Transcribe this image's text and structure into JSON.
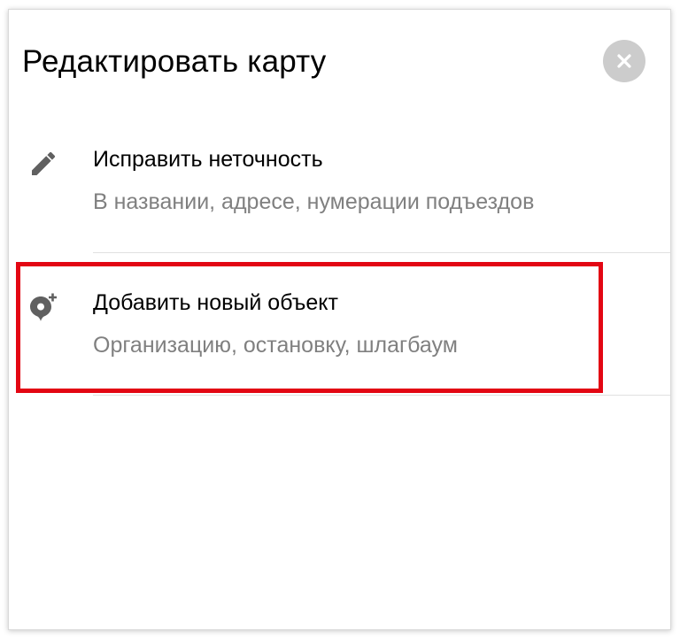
{
  "dialog": {
    "title": "Редактировать карту",
    "close_icon": "close-icon"
  },
  "items": [
    {
      "icon": "pencil-icon",
      "title": "Исправить неточность",
      "subtitle": "В названии, адресе, нумерации подъездов"
    },
    {
      "icon": "add-place-icon",
      "title": "Добавить новый объект",
      "subtitle": "Организацию, остановку, шлагбаум"
    }
  ],
  "colors": {
    "highlight": "#e30613",
    "close_button_bg": "#cccccc",
    "icon": "#606060",
    "subtitle": "#808080"
  }
}
